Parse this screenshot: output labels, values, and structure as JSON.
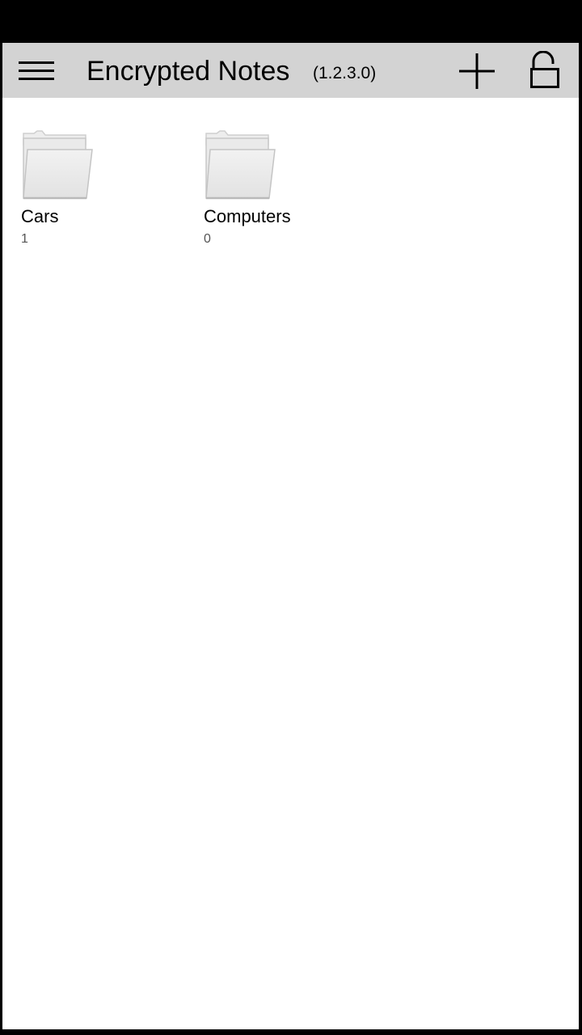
{
  "app_bar": {
    "title": "Encrypted Notes",
    "version": "(1.2.3.0)",
    "background_color": "#d3d3d3",
    "menu_icon": "hamburger-menu-icon",
    "add_icon": "plus-icon",
    "lock_icon": "lock-icon"
  },
  "folders": [
    {
      "name": "Cars",
      "count": "1",
      "icon": "folder-icon"
    },
    {
      "name": "Computers",
      "count": "0",
      "icon": "folder-icon"
    }
  ]
}
